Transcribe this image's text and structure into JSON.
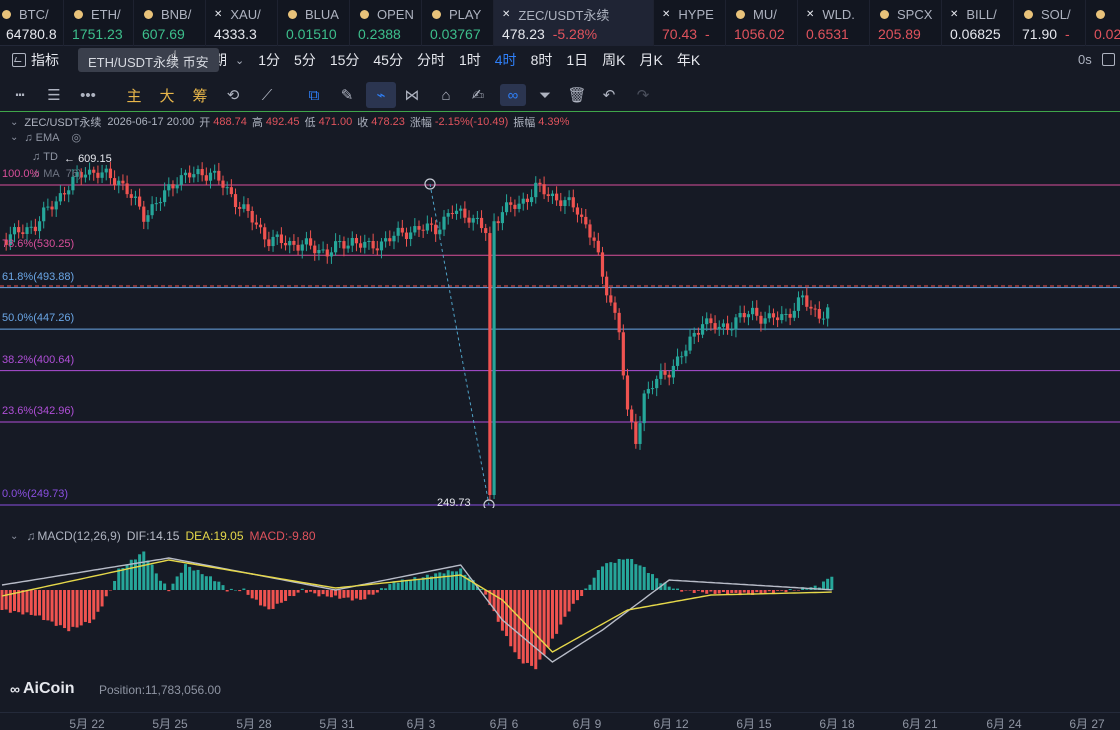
{
  "tickers": [
    {
      "name": "BTC/",
      "price": "64780.8",
      "color": "#e6e8ee",
      "icon": "coin-icon"
    },
    {
      "name": "ETH/",
      "price": "1751.23",
      "color": "#3dbf8c",
      "icon": "coin-icon"
    },
    {
      "name": "BNB/",
      "price": "607.69",
      "color": "#3dbf8c",
      "icon": "coin-icon"
    },
    {
      "name": "XAU/",
      "price": "4333.3",
      "color": "#e6e8ee",
      "icon": "x-icon"
    },
    {
      "name": "BLUA",
      "price": "0.01510",
      "color": "#3dbf8c",
      "icon": "coin-icon"
    },
    {
      "name": "OPEN",
      "price": "0.2388",
      "color": "#3dbf8c",
      "icon": "coin-icon"
    },
    {
      "name": "PLAY",
      "price": "0.03767",
      "color": "#3dbf8c",
      "icon": "coin-icon"
    },
    {
      "name": "ZEC/USDT永续",
      "price": "478.23",
      "change": "-5.28%",
      "color": "#e6e8ee",
      "icon": "x-icon",
      "active": true
    },
    {
      "name": "HYPE",
      "price": "70.43",
      "change": "-",
      "color": "#e0535d",
      "icon": "x-icon"
    },
    {
      "name": "MU/",
      "price": "1056.02",
      "color": "#e0535d",
      "icon": "coin-icon"
    },
    {
      "name": "WLD.",
      "price": "0.6531",
      "color": "#e0535d",
      "icon": "x-icon"
    },
    {
      "name": "SPCX",
      "price": "205.89",
      "color": "#e0535d",
      "icon": "coin-icon"
    },
    {
      "name": "BILL/",
      "price": "0.06825",
      "color": "#e6e8ee",
      "icon": "x-icon"
    },
    {
      "name": "SOL/",
      "price": "71.90",
      "change": "-",
      "color": "#e6e8ee",
      "icon": "coin-icon"
    },
    {
      "name": "",
      "price": "0.02",
      "color": "#e0535d",
      "icon": "coin-icon"
    }
  ],
  "toolbar": {
    "indicator_label": "指标",
    "period_label": "周期",
    "intervals": [
      "1分",
      "5分",
      "15分",
      "45分",
      "分时",
      "1时",
      "4时",
      "8时",
      "1日",
      "周K",
      "月K",
      "年K"
    ],
    "active_interval": "4时",
    "countdown": "0s",
    "tooltip": "ETH/USDT永续 币安",
    "main_btn": "主",
    "big_btn": "大",
    "chip_btn": "筹"
  },
  "ohlc": {
    "symbol": "ZEC/USDT永续",
    "time": "2026-06-17 20:00",
    "open_label": "开",
    "open": "488.74",
    "high_label": "高",
    "high": "492.45",
    "low_label": "低",
    "low": "471.00",
    "close_label": "收",
    "close": "478.23",
    "change_label": "涨幅",
    "change": "-2.15%(-10.49)",
    "amp_label": "振幅",
    "amp": "4.39%"
  },
  "indicators": {
    "ema": "EMA",
    "td": "TD",
    "ma": "MA",
    "ma_value": "76)"
  },
  "high_marker": "609.15",
  "low_marker": "249.73",
  "fib_levels": [
    {
      "label": "100.0%",
      "value": "",
      "color": "#d84f9a",
      "price": 609.15
    },
    {
      "label": "78.6%",
      "value": "(530.25)",
      "color": "#d84f9a",
      "price": 530.25
    },
    {
      "label": "61.8%",
      "value": "(493.88)",
      "color": "#6aa6e6",
      "price": 493.88
    },
    {
      "label": "50.0%",
      "value": "(447.26)",
      "color": "#6aa6e6",
      "price": 447.26
    },
    {
      "label": "38.2%",
      "value": "(400.64)",
      "color": "#b04fd8",
      "price": 400.64
    },
    {
      "label": "23.6%",
      "value": "(342.96)",
      "color": "#b04fd8",
      "price": 342.96
    },
    {
      "label": "0.0%",
      "value": "(249.73)",
      "color": "#8a4fe0",
      "price": 249.73
    }
  ],
  "macd": {
    "name": "MACD(12,26,9)",
    "dif": "DIF:14.15",
    "dea": "DEA:19.05",
    "macd": "MACD:-9.80"
  },
  "watermark": "AiCoin",
  "position": "Position:11,783,056.00",
  "x_labels": [
    "5月 22",
    "5月 25",
    "5月 28",
    "5月 31",
    "6月 3",
    "6月 6",
    "6月 9",
    "6月 12",
    "6月 15",
    "6月 18",
    "6月 21",
    "6月 24",
    "6月 27"
  ],
  "colors": {
    "up": "#26a69a",
    "down": "#ef5350",
    "accent": "#2f7ff7",
    "dif": "#b8bcc8",
    "dea": "#e6d84a"
  }
}
